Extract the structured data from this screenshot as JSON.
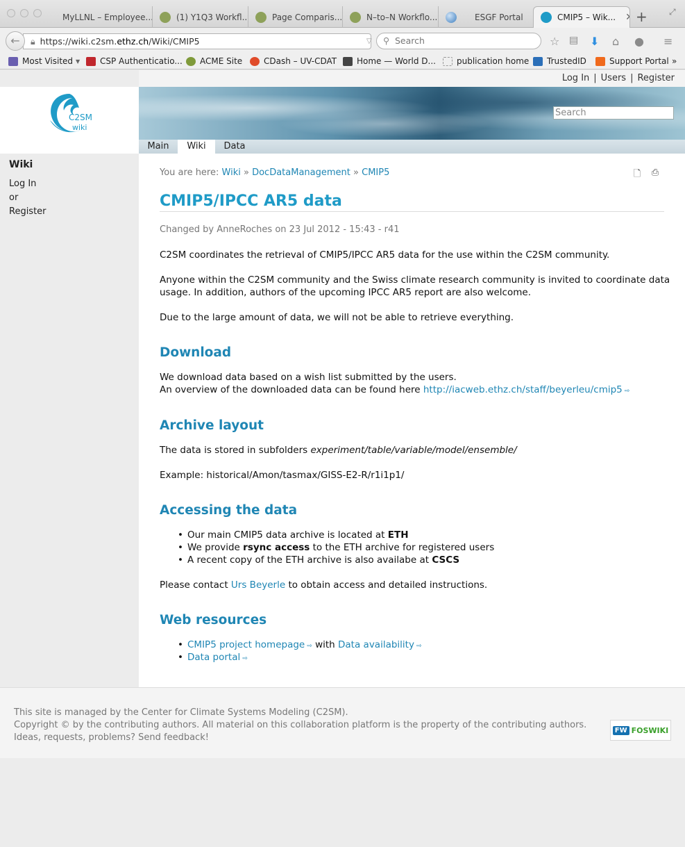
{
  "browser": {
    "tabs": [
      {
        "label": "MyLLNL – Employee..."
      },
      {
        "label": "(1) Y1Q3 Workfl..."
      },
      {
        "label": "Page Comparis..."
      },
      {
        "label": "N–to–N Workflo..."
      },
      {
        "label": "ESGF Portal"
      },
      {
        "label": "CMIP5 – Wik..."
      }
    ],
    "url_prefix": "https://wiki.c2sm.",
    "url_domain": "ethz.ch",
    "url_path": "/Wiki/CMIP5",
    "search_placeholder": "Search",
    "bookmarks": [
      {
        "label": "Most Visited",
        "icon": "most-visited-icon",
        "color": "#6a5fb0"
      },
      {
        "label": "CSP Authenticatio...",
        "icon": "csp-icon",
        "color": "#c0272d"
      },
      {
        "label": "ACME Site",
        "icon": "acme-icon",
        "color": "#7f9a3a"
      },
      {
        "label": "CDash – UV-CDAT",
        "icon": "cdash-icon",
        "color": "#e04b2a"
      },
      {
        "label": "Home — World D...",
        "icon": "wds-icon",
        "color": "#444444"
      },
      {
        "label": "publication home",
        "icon": "page-icon",
        "color": "#cccccc"
      },
      {
        "label": "TrustedID",
        "icon": "trustedid-icon",
        "color": "#2b6fb8"
      },
      {
        "label": "Support Portal",
        "icon": "blogger-icon",
        "color": "#f06a1d"
      }
    ]
  },
  "userbar": {
    "login": "Log In",
    "users": "Users",
    "register": "Register"
  },
  "banner": {
    "search_placeholder": "Search"
  },
  "logo": {
    "line1": "C2SM",
    "line2": "wiki"
  },
  "topnav": {
    "main": "Main",
    "wiki": "Wiki",
    "data": "Data"
  },
  "sidebar": {
    "heading": "Wiki",
    "login": "Log In",
    "or": "or",
    "register": "Register"
  },
  "breadcrumb": {
    "prefix": "You are here:",
    "items": [
      "Wiki",
      "DocDataManagement",
      "CMIP5"
    ]
  },
  "page": {
    "title": "CMIP5/IPCC AR5 data",
    "changed_by_prefix": "Changed by",
    "author": "AnneRoches",
    "changed_on": "on 23 Jul 2012 - 15:43 -",
    "revision": "r41",
    "intro1": "C2SM coordinates the retrieval of CMIP5/IPCC AR5 data for the use within the C2SM community.",
    "intro2a": "Anyone within the C2SM community and the Swiss climate research community is invited to coordinate data",
    "intro2b": "usage. In addition, authors of the upcoming IPCC AR5 report are also welcome.",
    "intro3": "Due to the large amount of data, we will not be able to retrieve everything.",
    "download": {
      "heading": "Download",
      "line1": "We download data based on a wish list submitted by the users.",
      "line2": "An overview of the downloaded data can be found here",
      "link": "http://iacweb.ethz.ch/staff/beyerleu/cmip5"
    },
    "archive": {
      "heading": "Archive layout",
      "stored_prefix": "The data is stored in subfolders",
      "stored_path": "experiment/table/variable/model/ensemble/",
      "example": "Example: historical/Amon/tasmax/GISS-E2-R/r1i1p1/"
    },
    "accessing": {
      "heading": "Accessing the data",
      "b1_pre": "Our main CMIP5 data archive is located at",
      "b1_bold": "ETH",
      "b2_pre": "We provide",
      "b2_bold": "rsync access",
      "b2_post": "to the ETH archive for registered users",
      "b3_pre": "A recent copy of the ETH archive is also availabe at",
      "b3_bold": "CSCS",
      "contact_pre": "Please contact",
      "contact_link": "Urs Beyerle",
      "contact_post": "to obtain access and detailed instructions."
    },
    "web": {
      "heading": "Web resources",
      "link1": "CMIP5 project homepage",
      "with": "with",
      "link2": "Data availability",
      "link3": "Data portal"
    }
  },
  "footer": {
    "line1": "This site is managed by the Center for Climate Systems Modeling (C2SM).",
    "line2": "Copyright © by the contributing authors. All material on this collaboration platform is the property of the contributing authors.",
    "line3": "Ideas, requests, problems? Send feedback!",
    "badge_fw": "FW",
    "badge_text": "FOSWIKI"
  }
}
